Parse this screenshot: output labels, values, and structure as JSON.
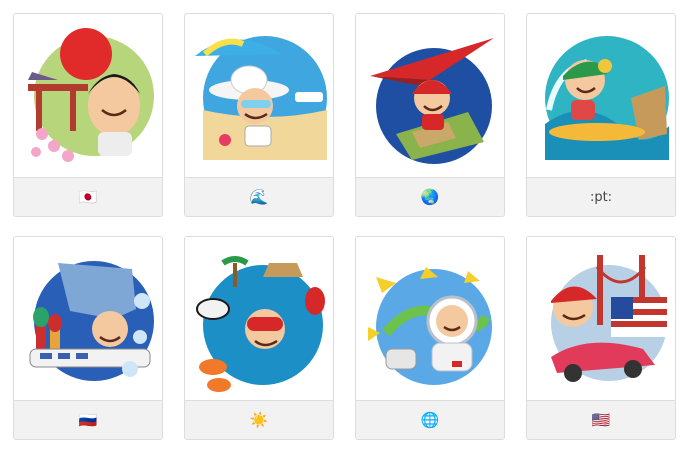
{
  "cards": [
    {
      "name": "japan",
      "caption": "🇯🇵",
      "icon": "flag-japan-icon"
    },
    {
      "name": "beach",
      "caption": "🌊",
      "icon": "wave-icon"
    },
    {
      "name": "glider",
      "caption": "🌏",
      "icon": "globe-icon"
    },
    {
      "name": "surf",
      "caption": ":pt:",
      "icon": "text-code"
    },
    {
      "name": "russia",
      "caption": "🇷🇺",
      "icon": "flag-russia-icon"
    },
    {
      "name": "diver",
      "caption": "☀️",
      "icon": "sun-icon"
    },
    {
      "name": "astronaut",
      "caption": "🌐",
      "icon": "globe-meridians-icon"
    },
    {
      "name": "usa",
      "caption": "🇺🇸",
      "icon": "flag-usa-icon"
    }
  ]
}
